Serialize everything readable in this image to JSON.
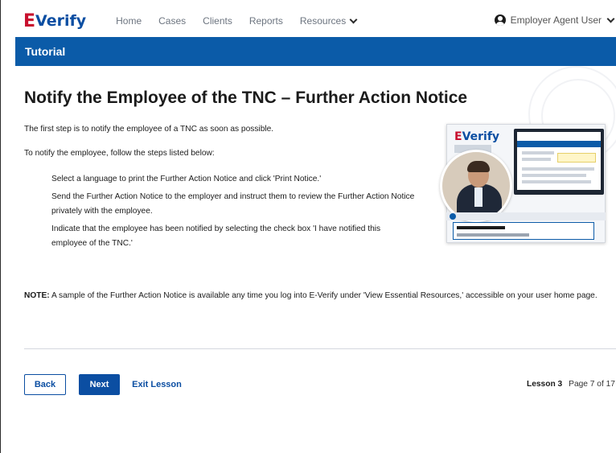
{
  "nav": {
    "logo_e": "E",
    "logo_verify": "Verify",
    "links": [
      "Home",
      "Cases",
      "Clients",
      "Reports",
      "Resources"
    ],
    "user": "Employer Agent User"
  },
  "banner": {
    "title": "Tutorial"
  },
  "content": {
    "heading": "Notify the Employee of the TNC – Further Action Notice",
    "intro": "The first step is to notify the employee of a TNC as soon as possible.",
    "lead": "To notify the employee, follow the steps listed below:",
    "steps": [
      "Select a language to print the Further Action Notice and click 'Print Notice.'",
      "Send the Further Action Notice to the employer and instruct them to review the Further Action Notice privately with the employee.",
      "Indicate that the employee has been notified by selecting the check box 'I have notified this employee of the TNC.'"
    ],
    "note_label": "NOTE:",
    "note_text": " A sample of the Further Action Notice is available any time you log into E-Verify under 'View Essential Resources,' accessible on your user home page."
  },
  "illustration": {
    "logo_e": "E",
    "logo_verify": "Verify"
  },
  "footer": {
    "back": "Back",
    "next": "Next",
    "exit": "Exit Lesson",
    "lesson": "Lesson 3",
    "page": "Page 7 of 17"
  }
}
